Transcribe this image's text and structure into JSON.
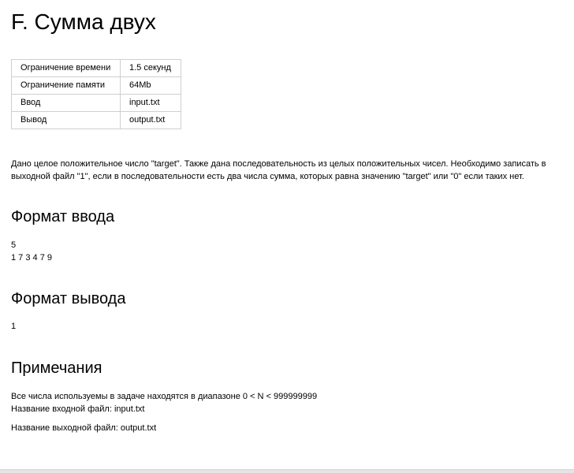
{
  "problem": {
    "title": "F. Сумма двух"
  },
  "limits": [
    {
      "key": "Ограничение времени",
      "value": "1.5 секунд"
    },
    {
      "key": "Ограничение памяти",
      "value": "64Mb"
    },
    {
      "key": "Ввод",
      "value": "input.txt"
    },
    {
      "key": "Вывод",
      "value": "output.txt"
    }
  ],
  "legend": {
    "text": "Дано целое положительное число \"target\". Также дана последовательность из целых положительных чисел. Необходимо записать в выходной файл \"1\", если в последовательности есть два числа сумма, которых равна значению \"target\" или \"0\" если таких нет."
  },
  "input_format": {
    "heading": "Формат ввода",
    "lines": [
      "5",
      "1 7 3 4 7 9"
    ]
  },
  "output_format": {
    "heading": "Формат вывода",
    "lines": [
      "1"
    ]
  },
  "notes": {
    "heading": "Примечания",
    "line1": "Все числа используемы в задаче находятся в диапазоне 0 < N < 999999999",
    "line2": "Название входной файл: input.txt",
    "line3": "Название выходной файл: output.txt"
  }
}
